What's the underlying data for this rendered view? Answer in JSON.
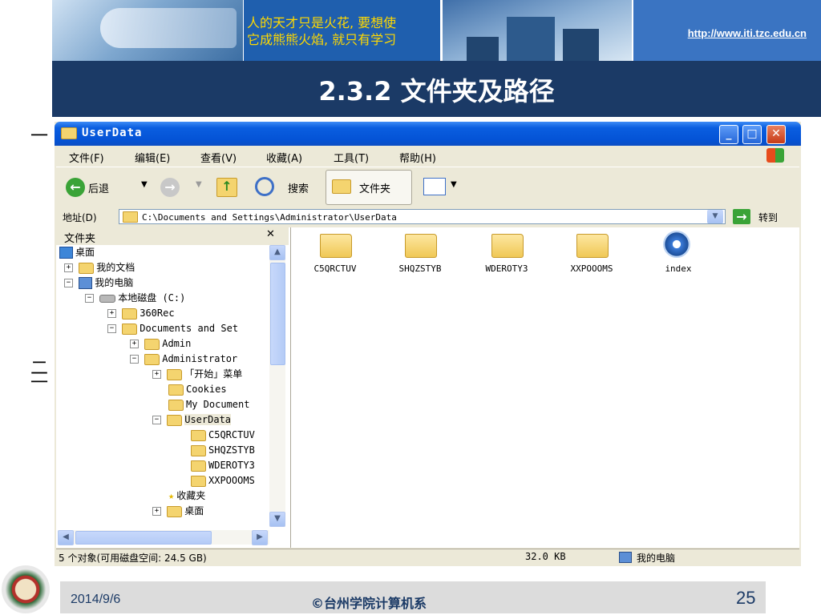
{
  "banner": {
    "quote_line1": "人的天才只是火花, 要想使",
    "quote_line2": "它成熊熊火焰, 就只有学习",
    "url": "http://www.iti.tzc.edu.cn",
    "url_color": "#ffffff",
    "slide_title": "2.3.2  文件夹及路径",
    "title_bg": "#1b3a66"
  },
  "bullets": {
    "b1": "一",
    "b2": "二",
    "b3": "一"
  },
  "window": {
    "title": "UserData",
    "menu": [
      "文件(F)",
      "编辑(E)",
      "查看(V)",
      "收藏(A)",
      "工具(T)",
      "帮助(H)"
    ],
    "toolbar": {
      "back": "后退",
      "search": "搜索",
      "folders": "文件夹"
    },
    "address_label": "地址(D)",
    "address_value": "C:\\Documents and Settings\\Administrator\\UserData",
    "go_label": "转到",
    "folders_pane_title": "文件夹",
    "tree": [
      {
        "label": "桌面"
      },
      {
        "label": "我的文档"
      },
      {
        "label": "我的电脑"
      },
      {
        "label": "本地磁盘 (C:)"
      },
      {
        "label": "360Rec"
      },
      {
        "label": "Documents and Set"
      },
      {
        "label": "Admin"
      },
      {
        "label": "Administrator"
      },
      {
        "label": "「开始」菜单"
      },
      {
        "label": "Cookies"
      },
      {
        "label": "My Document"
      },
      {
        "label": "UserData"
      },
      {
        "label": "C5QRCTUV"
      },
      {
        "label": "SHQZSTYB"
      },
      {
        "label": "WDEROTY3"
      },
      {
        "label": "XXPOOOMS"
      },
      {
        "label": "收藏夹"
      },
      {
        "label": "桌面"
      }
    ],
    "files": [
      {
        "name": "C5QRCTUV",
        "type": "folder"
      },
      {
        "name": "SHQZSTYB",
        "type": "folder"
      },
      {
        "name": "WDEROTY3",
        "type": "folder"
      },
      {
        "name": "XXPOOOMS",
        "type": "folder"
      },
      {
        "name": "index",
        "type": "media"
      }
    ],
    "status_left": "5 个对象(可用磁盘空间: 24.5 GB)",
    "status_size": "32.0 KB",
    "status_location": "我的电脑"
  },
  "footer": {
    "date": "2014/9/6",
    "copyright": "©台州学院计算机系",
    "page": "25"
  }
}
